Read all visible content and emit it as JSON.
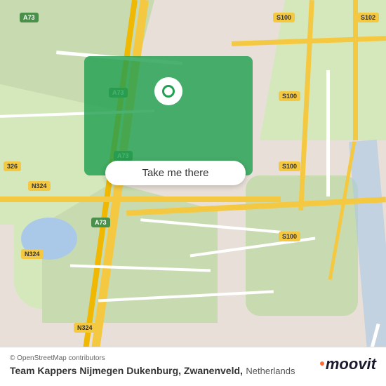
{
  "map": {
    "take_me_there_label": "Take me there",
    "copyright_text": "© OpenStreetMap contributors",
    "location_name": "Team Kappers Nijmegen Dukenburg, Zwanenveld,",
    "location_country": "Netherlands"
  },
  "road_labels": {
    "a73_top_left": "A73",
    "a73_mid_left": "A73",
    "a73_mid": "A73",
    "a73_bottom": "A73",
    "n324_left": "N324",
    "n324_bottom": "N324",
    "n324_mid": "N324",
    "s100_1": "S100",
    "s100_2": "S100",
    "s100_3": "S100",
    "s100_4": "S100",
    "s102": "S102",
    "r326": "326"
  },
  "branding": {
    "moovit_label": "moovit"
  }
}
